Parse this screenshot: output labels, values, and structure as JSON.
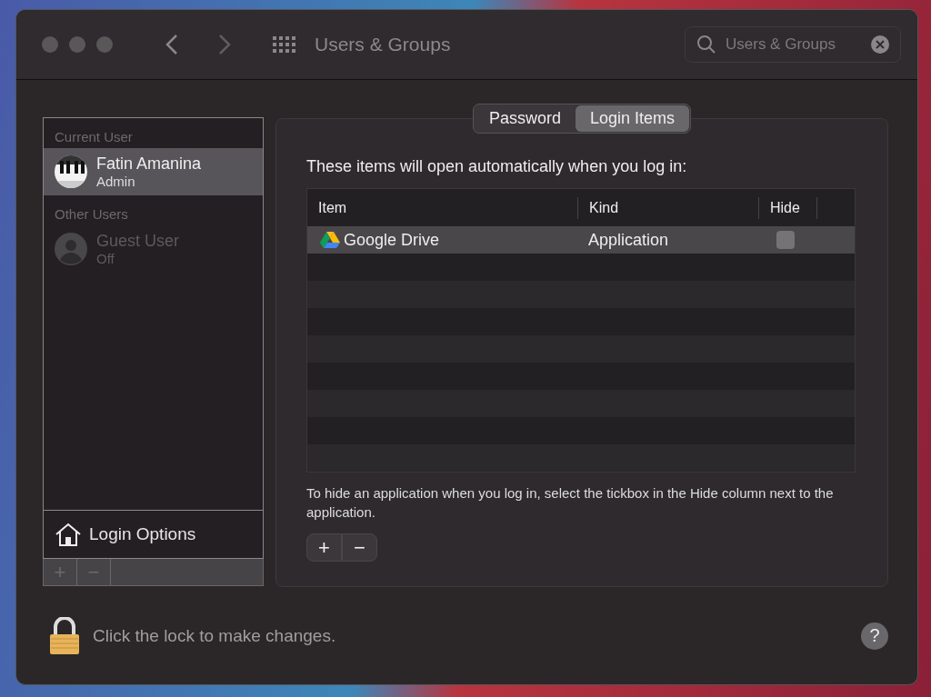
{
  "window": {
    "title": "Users & Groups",
    "search": {
      "value": "Users & Groups"
    }
  },
  "sidebar": {
    "sections": [
      {
        "heading": "Current User",
        "users": [
          {
            "name": "Fatin Amanina",
            "role": "Admin",
            "selected": true,
            "disabled": false
          }
        ]
      },
      {
        "heading": "Other Users",
        "users": [
          {
            "name": "Guest User",
            "role": "Off",
            "selected": false,
            "disabled": true
          }
        ]
      }
    ],
    "login_options": "Login Options",
    "buttons": [
      {
        "label": "+",
        "disabled": true
      },
      {
        "label": "−",
        "disabled": true
      }
    ]
  },
  "tabs": [
    {
      "label": "Password",
      "selected": false
    },
    {
      "label": "Login Items",
      "selected": true
    }
  ],
  "intro": "These items will open automatically when you log in:",
  "table": {
    "columns": [
      "Item",
      "Kind",
      "Hide"
    ],
    "rows": [
      {
        "item": "Google Drive",
        "kind": "Application",
        "hide": false,
        "selected": true
      }
    ]
  },
  "hint": "To hide an application when you log in, select the tickbox in the Hide column next to the application.",
  "buttons": [
    {
      "label": "+",
      "disabled": false
    },
    {
      "label": "−",
      "disabled": false
    }
  ],
  "lock": "Click the lock to make changes.",
  "help": "?"
}
